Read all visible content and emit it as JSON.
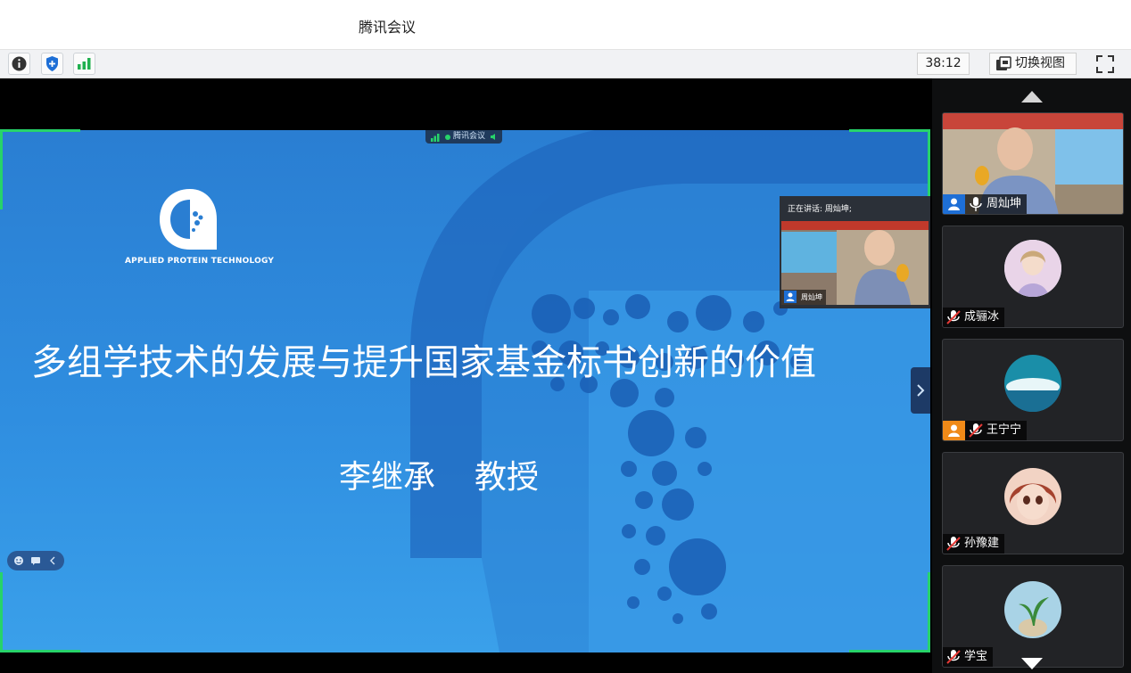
{
  "window": {
    "title": "腾讯会议"
  },
  "toolbar": {
    "info_icon": "info-icon",
    "shield_icon": "shield-icon",
    "signal_icon": "signal-icon",
    "timer": "38:12",
    "switch_view_label": "切换视图",
    "fullscreen_icon": "fullscreen-icon"
  },
  "share": {
    "badge_label": "腾讯会议",
    "logo_text": "APPLIED PROTEIN TECHNOLOGY",
    "slide_title": "多组学技术的发展与提升国家基金标书创新的价值",
    "presenter_name": "李继承",
    "presenter_title": "教授",
    "speaker_caption": "正在讲话: 周灿坤;",
    "speaker_name": "周灿坤"
  },
  "participants": [
    {
      "name": "周灿坤",
      "mic": "on",
      "role_icon": "user-icon"
    },
    {
      "name": "成骊冰",
      "mic": "muted"
    },
    {
      "name": "王宁宁",
      "mic": "muted",
      "role_icon": "user-icon"
    },
    {
      "name": "孙豫建",
      "mic": "muted"
    },
    {
      "name": "学宝",
      "mic": "muted"
    }
  ],
  "colors": {
    "accent_green": "#27d36a",
    "slide_blue": "#2f8ee0",
    "host_blue": "#1e6fd6",
    "guest_orange": "#f08a18"
  }
}
